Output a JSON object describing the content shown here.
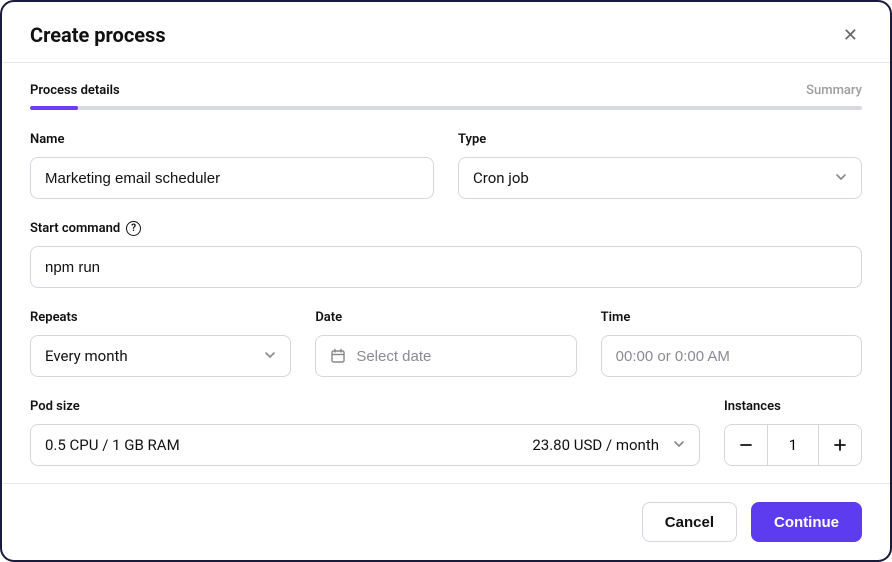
{
  "modal": {
    "title": "Create process",
    "close_label": "✕"
  },
  "steps": {
    "current": "Process details",
    "next": "Summary"
  },
  "fields": {
    "name": {
      "label": "Name",
      "value": "Marketing email scheduler"
    },
    "type": {
      "label": "Type",
      "value": "Cron job"
    },
    "start_command": {
      "label": "Start command",
      "value": "npm run"
    },
    "repeats": {
      "label": "Repeats",
      "value": "Every month"
    },
    "date": {
      "label": "Date",
      "placeholder": "Select date"
    },
    "time": {
      "label": "Time",
      "placeholder": "00:00 or 0:00 AM"
    },
    "pod_size": {
      "label": "Pod size",
      "spec": "0.5 CPU / 1 GB RAM",
      "price": "23.80 USD / month"
    },
    "instances": {
      "label": "Instances",
      "value": "1"
    }
  },
  "footer": {
    "cancel": "Cancel",
    "continue": "Continue"
  },
  "colors": {
    "accent": "#5d3cf0"
  }
}
